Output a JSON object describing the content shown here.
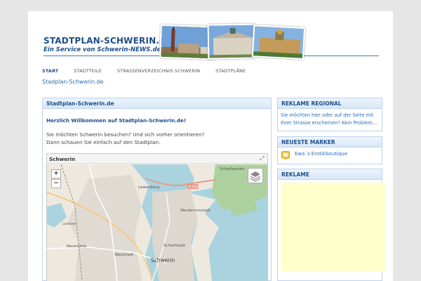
{
  "header": {
    "logo_line1": "STADTPLAN-SCHWERIN.de",
    "logo_line2": "Ein Service von Schwerin-NEWS.de"
  },
  "nav": {
    "items": [
      {
        "label": "START",
        "active": true
      },
      {
        "label": "STADTTEILE",
        "active": false
      },
      {
        "label": "STRASSENVERZEICHNIS SCHWERIN",
        "active": false
      },
      {
        "label": "STADTPLÄNE",
        "active": false
      }
    ]
  },
  "breadcrumb": "Stadplan-Schwerin.de",
  "main": {
    "title": "Stadtplan-Schwerin.de",
    "welcome": "Herzlich Willkommen auf Stadtplan-Schwerin.de!",
    "intro_line1": "Sie möchten Schwerin besuchen? Und sich vorher orientieren?",
    "intro_line2": "Dann schauen Sie einfach auf den Stadtplan.",
    "map": {
      "title": "Schwerin",
      "zoom_in": "+",
      "zoom_out": "−",
      "place_labels": {
        "schelfwerder": "Schelfwerder",
        "lewenberg": "Lewenberg",
        "werdervorstadt": "Werdervorstadt",
        "neumuehle": "Neumühle",
        "weststadt": "Weststadt",
        "schelfstadt": "Schelfstadt",
        "schwerin": "Schwerin",
        "lankow": "Lankow",
        "road_b104": "B 104"
      }
    }
  },
  "sidebar": {
    "regional": {
      "title": "REKLAME REGIONAL",
      "text": "Sie möchten hier oder auf der Seite mit ihrer Strasse erscheinen? Kein Problem..."
    },
    "markers": {
      "title": "NEUESTE MARKER",
      "link": "Ewa´s Erotikboutique"
    },
    "ads": {
      "title": "REKLAME"
    }
  },
  "colors": {
    "brand_blue": "#1d4f8c",
    "link_blue": "#2a6db5",
    "box_border": "#bcd3ec",
    "ad_yellow": "#ffffcc",
    "water": "#aad3df",
    "forest": "#add19e"
  },
  "icons": {
    "fullscreen": "fullscreen-icon",
    "layers": "layers-icon",
    "marker": "marker-icon"
  }
}
